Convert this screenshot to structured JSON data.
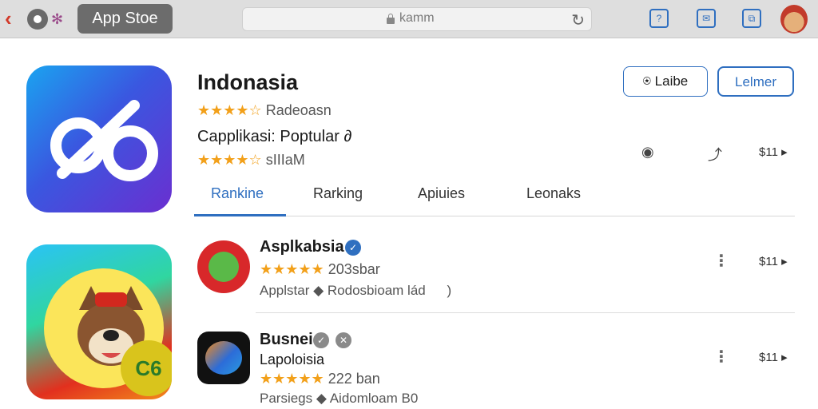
{
  "browser": {
    "store_label": "App Stoe",
    "url": "kamm",
    "icons": [
      "back-icon",
      "logo-icon",
      "lock-icon",
      "reload-icon",
      "chat-icon",
      "bookmark-icon",
      "share-icon",
      "profile-avatar"
    ]
  },
  "header": {
    "title": "Indonasia",
    "stars": "★★★★☆",
    "rating_text": "Radeoasn",
    "subtitle": "Capplikasi: Poptular",
    "subtitle_suffix": "∂",
    "stars2": "★★★★☆",
    "rating_text2": "sIIIaM",
    "btn_secondary": "Laibe",
    "btn_primary": "Lelmer",
    "price": "$11 ▸",
    "accent_color": "#2f6fc0",
    "star_color": "#f2a01a"
  },
  "tabs": [
    {
      "label": "Rankine",
      "active": true
    },
    {
      "label": "Rarking",
      "active": false
    },
    {
      "label": "Apiuies",
      "active": false
    },
    {
      "label": "Leonaks",
      "active": false
    }
  ],
  "list": [
    {
      "name": "Asplkabsia",
      "badge": "✓",
      "badge_color": "#2f6fc0",
      "stars": "★★★★★",
      "count": "203sbar",
      "developer": "Applstar ◆ Rodosbioam lád",
      "developer_suffix": ")",
      "price": "$11 ▸"
    },
    {
      "name": "Busnei",
      "badge": "✓",
      "badge2": "✕",
      "badge_color": "#8a8a8a",
      "subname": "Lapoloisia",
      "stars": "★★★★★",
      "count": "222 ban",
      "developer": "Parsiegs ◆ Aidomloam B0",
      "price": "$11 ▸"
    }
  ]
}
